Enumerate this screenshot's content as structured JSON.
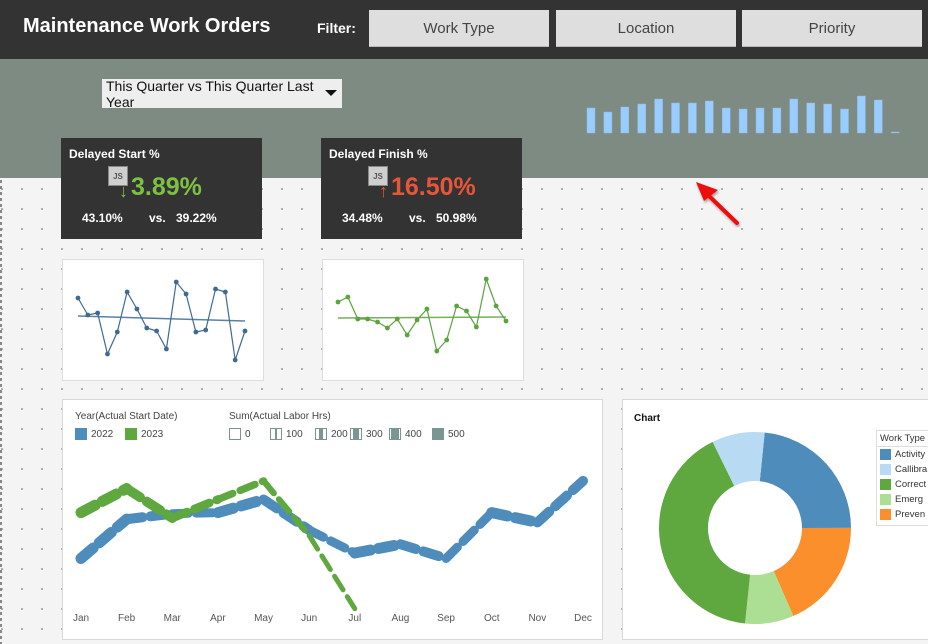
{
  "header": {
    "title": "Maintenance Work Orders",
    "filter_label": "Filter:",
    "filters": [
      "Work Type",
      "Location",
      "Priority"
    ]
  },
  "period_select": {
    "value": "This Quarter vs This Quarter Last Year"
  },
  "mini_bars": {
    "color": "#99ccff",
    "relative_heights": [
      25,
      21,
      26,
      29,
      34,
      30,
      30,
      32,
      25,
      24,
      25,
      25,
      34,
      30,
      29,
      24,
      37,
      33,
      1
    ]
  },
  "kpis": [
    {
      "title": "Delayed Start %",
      "value": "3.89%",
      "direction": "down",
      "arrow": "↓",
      "color": "#7cc142",
      "current": "43.10%",
      "vs": "vs.",
      "previous": "39.22%",
      "icon_label": "JS"
    },
    {
      "title": "Delayed Finish %",
      "value": "16.50%",
      "direction": "up",
      "arrow": "↑",
      "color": "#e8563a",
      "current": "34.48%",
      "vs": "vs.",
      "previous": "50.98%",
      "icon_label": "JS"
    }
  ],
  "sparklines": [
    {
      "color": "#3f6b93",
      "values": [
        62,
        45,
        47,
        6,
        28,
        68,
        51,
        32,
        29,
        11,
        78,
        66,
        28,
        30,
        71,
        68,
        0,
        29
      ],
      "trend": [
        44,
        39
      ]
    },
    {
      "color": "#5ca33c",
      "values": [
        49,
        54,
        32,
        32,
        29,
        23,
        32,
        16,
        31,
        42,
        0,
        11,
        45,
        40,
        24,
        72,
        45,
        30
      ],
      "trend": [
        33,
        34
      ]
    }
  ],
  "line_chart": {
    "legend_color_title": "Year(Actual Start Date)",
    "legend_size_title": "Sum(Actual Labor Hrs)",
    "series_legend": [
      {
        "name": "2022",
        "color": "#4e8cbc"
      },
      {
        "name": "2023",
        "color": "#5ea83f"
      }
    ],
    "size_legend": [
      "0",
      "100",
      "200",
      "300",
      "400",
      "500"
    ]
  },
  "chart_data": [
    {
      "type": "line",
      "title": "",
      "xlabel": "",
      "ylabel": "",
      "categories": [
        "Jan",
        "Feb",
        "Mar",
        "Apr",
        "May",
        "Jun",
        "Jul",
        "Aug",
        "Sep",
        "Oct",
        "Nov",
        "Dec"
      ],
      "series": [
        {
          "name": "2022",
          "color": "#4e8cbc",
          "values": [
            29,
            65,
            70,
            71,
            83,
            55,
            34,
            42,
            29,
            71,
            62,
            100
          ]
        },
        {
          "name": "2023",
          "color": "#5ea83f",
          "values": [
            71,
            93,
            66,
            83,
            100,
            50,
            -17,
            null,
            null,
            null,
            null,
            null
          ]
        }
      ],
      "line_width_by": "Sum(Actual Labor Hrs)",
      "ylim": [
        -20,
        110
      ]
    },
    {
      "type": "pie",
      "title": "Chart",
      "donut": true,
      "legend_title": "Work Type",
      "categories": [
        "Activity",
        "Callibration",
        "Corrective",
        "Emergency",
        "Preventive"
      ],
      "labels_visible": [
        "Activity",
        "Callibra",
        "Correct",
        "Emerg",
        "Preven"
      ],
      "values": [
        23.4,
        8.9,
        41.1,
        8.2,
        18.5
      ],
      "colors": [
        "#4e8cbc",
        "#b8daf2",
        "#5ea83f",
        "#acdf94",
        "#fb8f2c"
      ]
    }
  ]
}
